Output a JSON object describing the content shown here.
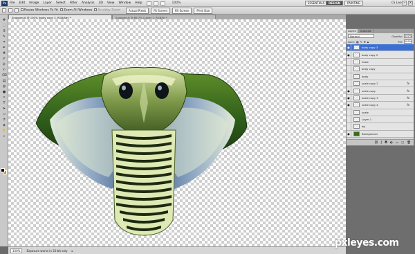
{
  "app": {
    "logo": "Ps",
    "zoom_display": "100%"
  },
  "menu": [
    "File",
    "Edit",
    "Image",
    "Layer",
    "Select",
    "Filter",
    "Analysis",
    "3D",
    "View",
    "Window",
    "Help"
  ],
  "workspaces": {
    "essentials": "ESSENTIALS",
    "design": "DESIGN",
    "painting": "PAINTING"
  },
  "cs_live": "CS Live",
  "options_bar": {
    "resize_windows": "Resize Windows To Fit",
    "zoom_all_windows": "Zoom All Windows",
    "scrubby_zoom": "Scrubby Zoom",
    "actual_pixels": "Actual Pixels",
    "fit_screen": "Fit Screen",
    "fill_screen": "Fill Screen",
    "print_size": "Print Size"
  },
  "tabs": [
    {
      "label": "Snapped-8 @ 100% (body copy 3, RGB/8#) *",
      "active": true
    },
    {
      "label": "Snapped-8 @ 66.7% (Layer 1, RGB/8) *",
      "active": false
    }
  ],
  "tools": [
    "move-icon",
    "marquee-icon",
    "lasso-icon",
    "quick-select-icon",
    "crop-icon",
    "eyedropper-icon",
    "healing-icon",
    "brush-icon",
    "stamp-icon",
    "history-brush-icon",
    "eraser-icon",
    "gradient-icon",
    "blur-icon",
    "dodge-icon",
    "pen-icon",
    "type-icon",
    "path-select-icon",
    "shape-icon",
    "3d-rotate-icon",
    "3d-camera-icon",
    "hand-icon",
    "zoom-icon"
  ],
  "tool_glyphs": [
    "✥",
    "⬚",
    "ϑ",
    "✎",
    "⌗",
    "✒",
    "✚",
    "✐",
    "⎆",
    "✍",
    "⌫",
    "▤",
    "◍",
    "●",
    "✑",
    "T",
    "➤",
    "▭",
    "⟳",
    "◈",
    "✋",
    "⌕"
  ],
  "colors": {
    "foreground": "#000000",
    "background": "#e58a12",
    "selected_layer": "#3b6fd2"
  },
  "status": {
    "zoom": "100%",
    "info": "Exposure works in 32-bit only"
  },
  "layers_panel": {
    "tabs": [
      "Layers",
      "Channels"
    ],
    "blend_mode": "Normal",
    "opacity_label": "Opacity:",
    "opacity": "100%",
    "lock_label": "Lock:",
    "fill_label": "Fill:",
    "fill": "100%",
    "items": [
      {
        "name": "body copy 3",
        "visible": true,
        "selected": true,
        "fx": false,
        "thumb": "checker"
      },
      {
        "name": "body copy 2",
        "visible": true,
        "selected": false,
        "fx": false,
        "thumb": "checker"
      },
      {
        "name": "head",
        "visible": false,
        "selected": false,
        "fx": false,
        "thumb": "checker"
      },
      {
        "name": "body copy",
        "visible": false,
        "selected": false,
        "fx": false,
        "thumb": "checker"
      },
      {
        "name": "body",
        "visible": false,
        "selected": false,
        "fx": false,
        "thumb": "checker"
      },
      {
        "name": "scale copy 2",
        "visible": false,
        "selected": false,
        "fx": true,
        "thumb": "checker"
      },
      {
        "name": "scale copy",
        "visible": true,
        "selected": false,
        "fx": true,
        "thumb": "checker"
      },
      {
        "name": "scale copy 3",
        "visible": true,
        "selected": false,
        "fx": true,
        "thumb": "checker"
      },
      {
        "name": "scale copy 4",
        "visible": true,
        "selected": false,
        "fx": true,
        "thumb": "checker"
      },
      {
        "name": "scale",
        "visible": false,
        "selected": false,
        "fx": false,
        "thumb": "checker"
      },
      {
        "name": "Layer 1",
        "visible": false,
        "selected": false,
        "fx": false,
        "thumb": "checker"
      },
      {
        "name": "bg",
        "visible": false,
        "selected": false,
        "fx": false,
        "thumb": "checker"
      },
      {
        "name": "Background",
        "visible": true,
        "selected": false,
        "fx": false,
        "thumb": "green"
      }
    ],
    "fx_label": "fx",
    "bottom_icons": [
      "link-icon",
      "fx-icon",
      "mask-icon",
      "adjustment-icon",
      "group-icon",
      "new-layer-icon",
      "trash-icon"
    ]
  },
  "watermark": "pxleyes.com"
}
